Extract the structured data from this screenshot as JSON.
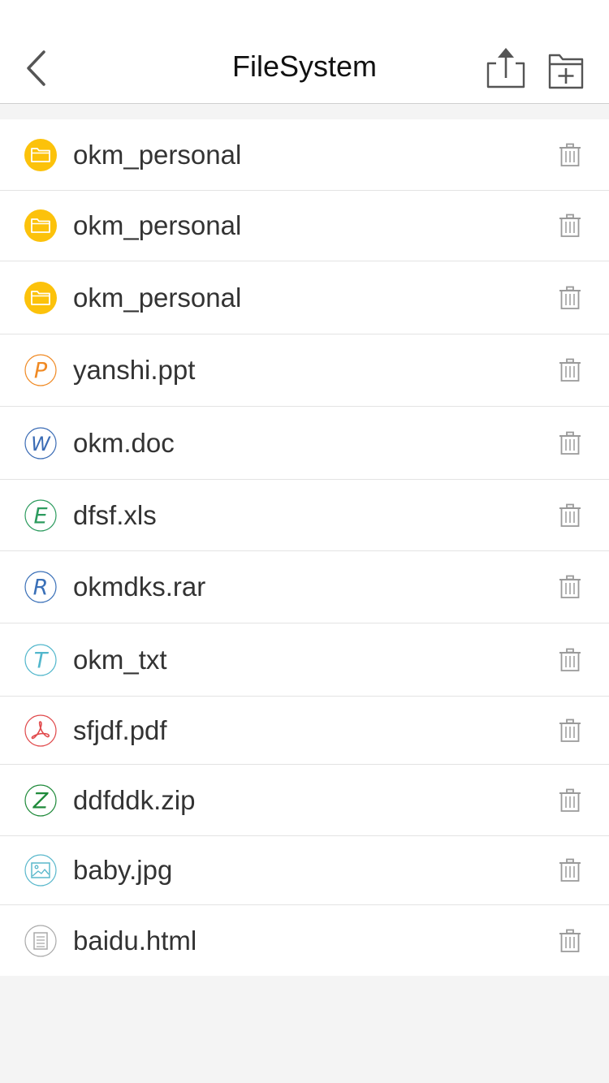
{
  "header": {
    "title": "FileSystem"
  },
  "files": [
    {
      "name": "okm_personal",
      "type": "folder",
      "icon": "folder-icon",
      "color": "#fcc20b"
    },
    {
      "name": "okm_personal",
      "type": "folder",
      "icon": "folder-icon",
      "color": "#fcc20b"
    },
    {
      "name": "okm_personal",
      "type": "folder",
      "icon": "folder-icon",
      "color": "#fcc20b"
    },
    {
      "name": "yanshi.ppt",
      "type": "ppt",
      "icon": "ppt-icon",
      "glyph": "P",
      "color": "#f08a24"
    },
    {
      "name": "okm.doc",
      "type": "doc",
      "icon": "word-icon",
      "glyph": "W",
      "color": "#3b6cb5"
    },
    {
      "name": "dfsf.xls",
      "type": "xls",
      "icon": "excel-icon",
      "glyph": "E",
      "color": "#2c9b5e"
    },
    {
      "name": "okmdks.rar",
      "type": "rar",
      "icon": "rar-icon",
      "glyph": "R",
      "color": "#3a70b8"
    },
    {
      "name": "okm_txt",
      "type": "txt",
      "icon": "text-icon",
      "glyph": "T",
      "color": "#52b7cc"
    },
    {
      "name": "sfjdf.pdf",
      "type": "pdf",
      "icon": "pdf-icon",
      "color": "#e0494b"
    },
    {
      "name": "ddfddk.zip",
      "type": "zip",
      "icon": "zip-icon",
      "glyph": "Z",
      "color": "#1f8a3a"
    },
    {
      "name": "baby.jpg",
      "type": "image",
      "icon": "image-icon",
      "color": "#5ab8cc"
    },
    {
      "name": "baidu.html",
      "type": "html",
      "icon": "html-document-icon",
      "color": "#aaaaaa"
    }
  ],
  "colors": {
    "trash": "#9a9a9a",
    "nav_icon": "#555555",
    "separator": "#e3e3e3",
    "background": "#f4f4f4"
  }
}
